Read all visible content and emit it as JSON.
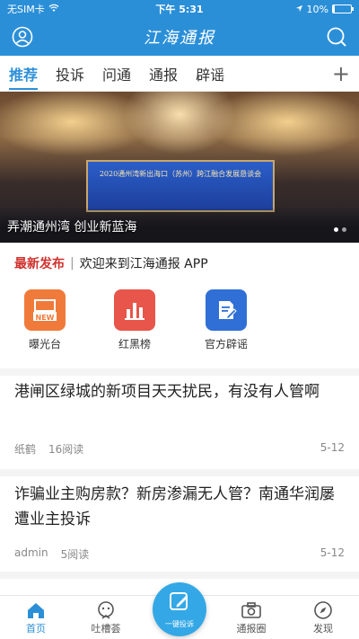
{
  "status_bar": {
    "carrier": "无SIM卡",
    "time": "下午 5:31",
    "battery": "10%",
    "battery_level": 0.1
  },
  "header": {
    "title": "江海通报"
  },
  "tabs": [
    "推荐",
    "投诉",
    "问通",
    "通报",
    "辟谣"
  ],
  "banner": {
    "caption": "弄潮通州湾 创业新蓝海",
    "stage_text": "2020通州湾新出海口（苏州）跨江融合发展恳谈会"
  },
  "ticker": {
    "label": "最新发布",
    "text": "欢迎来到江海通报 APP"
  },
  "quick_links": [
    {
      "label": "曝光台",
      "badge": "NEW",
      "color": "#f07a3a"
    },
    {
      "label": "红黑榜",
      "color": "#e8554a"
    },
    {
      "label": "官方辟谣",
      "color": "#2f6fd6"
    }
  ],
  "articles": [
    {
      "title": "港闸区绿城的新项目天天扰民，有没有人管啊",
      "author": "纸鹤",
      "reads": "16阅读",
      "date": "5-12"
    },
    {
      "title": "诈骗业主购房款？新房渗漏无人管？南通华润屡遭业主投诉",
      "author": "admin",
      "reads": "5阅读",
      "date": "5-12"
    }
  ],
  "tabbar": {
    "home": "首页",
    "complain": "吐槽荟",
    "fab": "一键投诉",
    "circle": "通报圈",
    "discover": "发现"
  },
  "colors": {
    "brand": "#2b8fd8",
    "accent": "#d0312d"
  }
}
